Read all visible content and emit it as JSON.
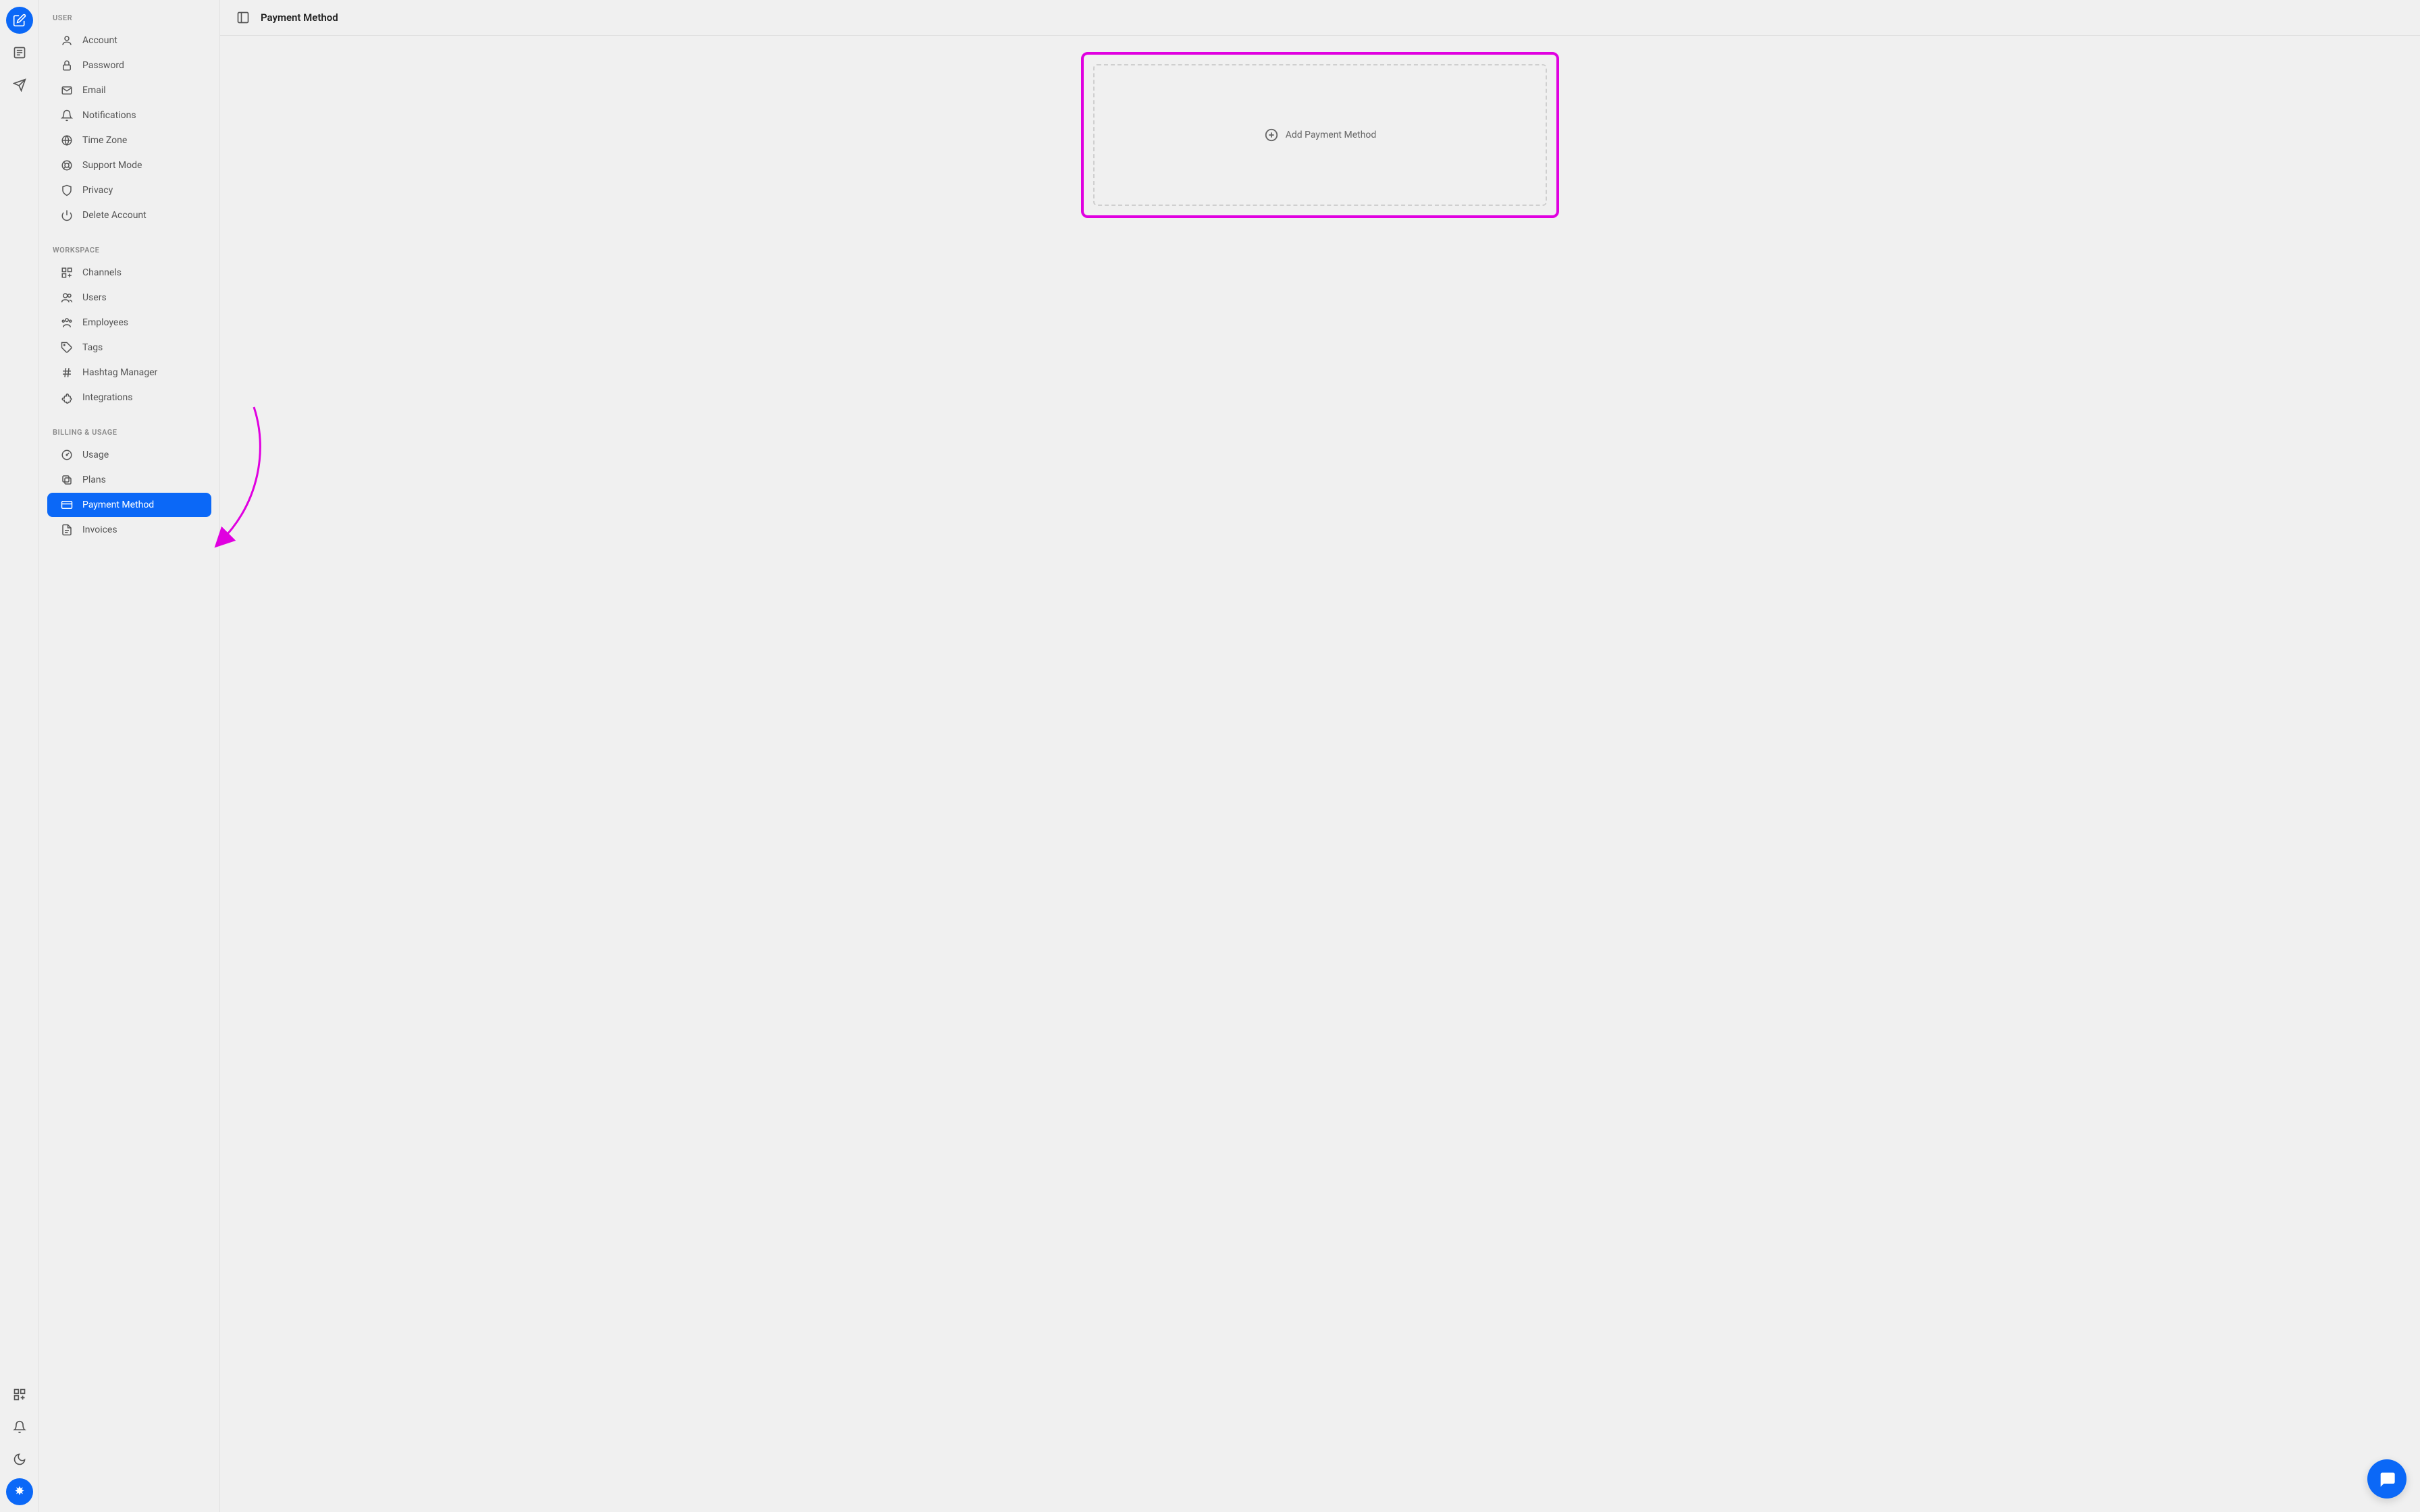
{
  "page_title": "Payment Method",
  "sections": {
    "user": {
      "header": "USER",
      "items": [
        {
          "label": "Account",
          "icon": "user"
        },
        {
          "label": "Password",
          "icon": "lock"
        },
        {
          "label": "Email",
          "icon": "mail"
        },
        {
          "label": "Notifications",
          "icon": "bell"
        },
        {
          "label": "Time Zone",
          "icon": "globe"
        },
        {
          "label": "Support Mode",
          "icon": "lifebuoy"
        },
        {
          "label": "Privacy",
          "icon": "shield"
        },
        {
          "label": "Delete Account",
          "icon": "power"
        }
      ]
    },
    "workspace": {
      "header": "WORKSPACE",
      "items": [
        {
          "label": "Channels",
          "icon": "grid-plus"
        },
        {
          "label": "Users",
          "icon": "users"
        },
        {
          "label": "Employees",
          "icon": "employees"
        },
        {
          "label": "Tags",
          "icon": "tag"
        },
        {
          "label": "Hashtag Manager",
          "icon": "hash"
        },
        {
          "label": "Integrations",
          "icon": "puzzle"
        }
      ]
    },
    "billing": {
      "header": "BILLING & USAGE",
      "items": [
        {
          "label": "Usage",
          "icon": "gauge"
        },
        {
          "label": "Plans",
          "icon": "stack"
        },
        {
          "label": "Payment Method",
          "icon": "card",
          "active": true
        },
        {
          "label": "Invoices",
          "icon": "file"
        }
      ]
    }
  },
  "add_payment_label": "Add Payment Method"
}
